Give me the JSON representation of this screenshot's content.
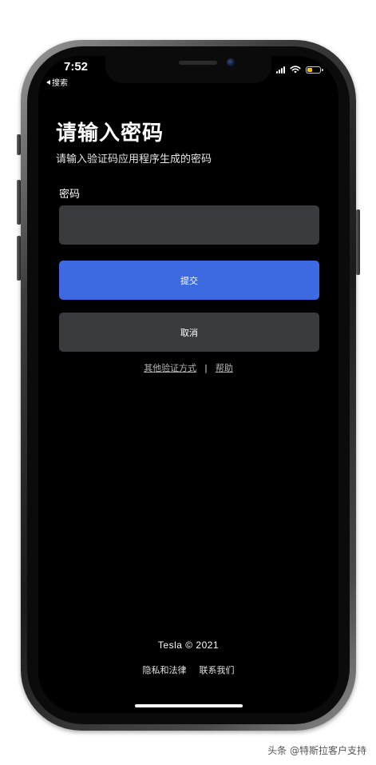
{
  "status_bar": {
    "time": "7:52",
    "back_label": "搜索"
  },
  "page": {
    "title": "请输入密码",
    "subtitle": "请输入验证码应用程序生成的密码",
    "password_label": "密码",
    "password_value": "",
    "submit_label": "提交",
    "cancel_label": "取消",
    "other_methods_link": "其他验证方式",
    "separator": "|",
    "help_link": "帮助"
  },
  "footer": {
    "brand": "Tesla © 2021",
    "privacy_link": "隐私和法律",
    "contact_link": "联系我们"
  },
  "watermark": "头条 @特斯拉客户支持",
  "colors": {
    "background": "#000000",
    "primary": "#3e6ae1",
    "field": "#3a3b3f",
    "battery": "#f5c400"
  },
  "icons": [
    "back-arrow-icon",
    "signal-icon",
    "wifi-icon",
    "battery-icon"
  ]
}
